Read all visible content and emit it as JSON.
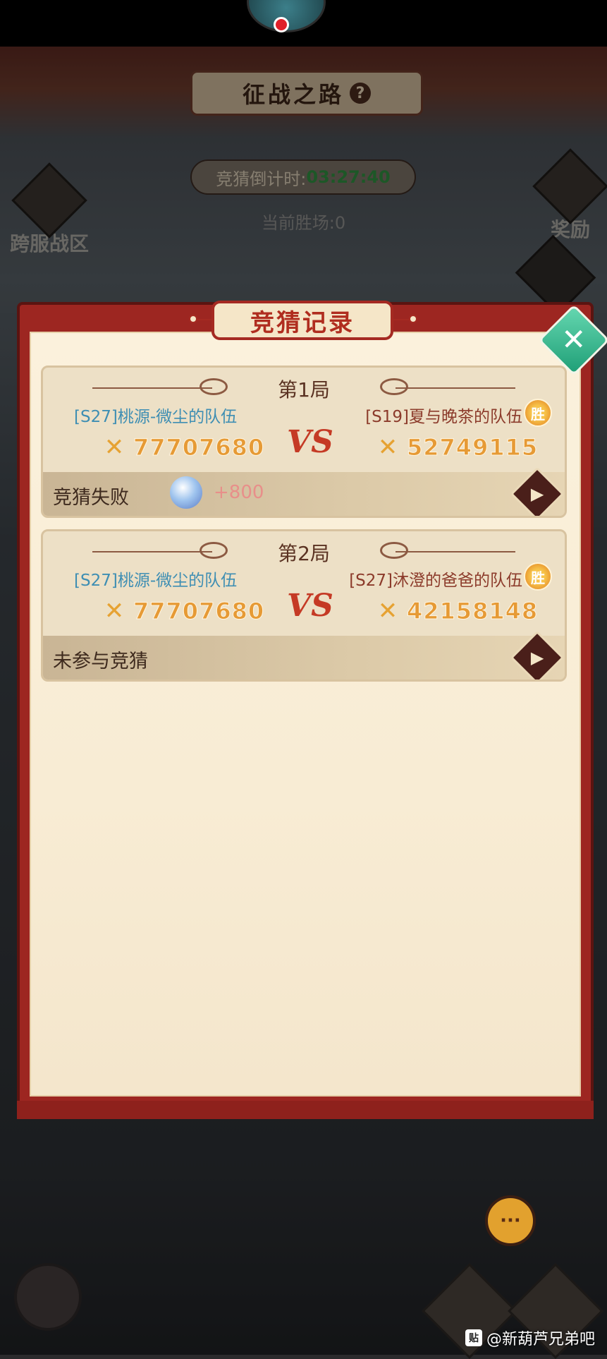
{
  "top": {
    "record_indicator": "recording"
  },
  "header": {
    "title": "征战之路",
    "help_icon": "?"
  },
  "countdown": {
    "label": "竞猜倒计时:",
    "time": "03:27:40"
  },
  "wins": {
    "text": "当前胜场:0"
  },
  "side": {
    "left_label": "跨服战区",
    "right_label": "奖励"
  },
  "dialog": {
    "title": "竞猜记录",
    "close_label": "✕",
    "matches": [
      {
        "round": "第1局",
        "left_team": "[S27]桃源-微尘的队伍",
        "left_power": "77707680",
        "right_team": "[S19]夏与晚茶的队伍",
        "right_power": "52749115",
        "vs": "VS",
        "winner_badge": "胜",
        "status": "竞猜失败",
        "reward": "+800"
      },
      {
        "round": "第2局",
        "left_team": "[S27]桃源-微尘的队伍",
        "left_power": "77707680",
        "right_team": "[S27]沐澄的爸爸的队伍",
        "right_power": "42158148",
        "vs": "VS",
        "winner_badge": "胜",
        "status": "未参与竞猜"
      }
    ]
  },
  "chat": {
    "label": "···"
  },
  "watermark": {
    "icon": "贴",
    "text": "@新葫芦兄弟吧"
  },
  "colors": {
    "panel_red": "#9d2621",
    "team_blue": "#3e8eb3",
    "score_orange": "#e69a35",
    "close_green": "#1f9f77",
    "timer_green": "#2f8d3f"
  }
}
